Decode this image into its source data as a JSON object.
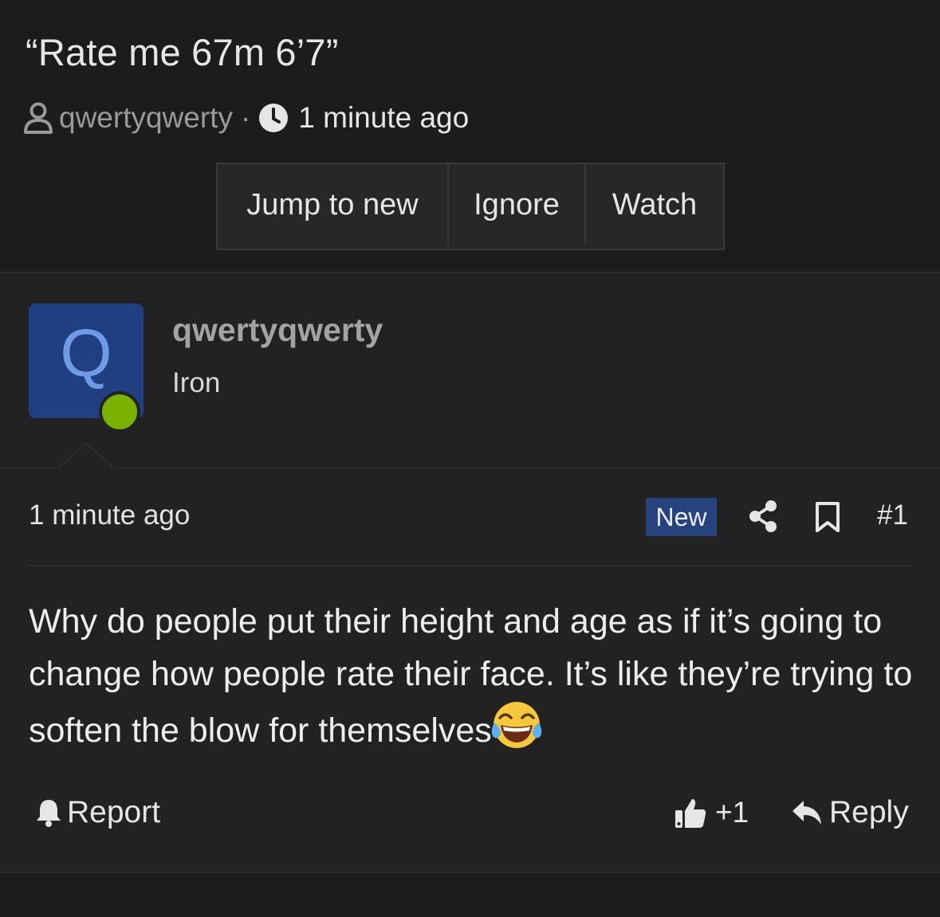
{
  "thread": {
    "title": "“Rate me 67m 6’7”",
    "author": "qwertyqwerty",
    "separator": "·",
    "time": "1 minute ago"
  },
  "actions": {
    "jump_label": "Jump to new",
    "ignore_label": "Ignore",
    "watch_label": "Watch"
  },
  "post": {
    "avatar_letter": "Q",
    "username": "qwertyqwerty",
    "rank": "Iron",
    "time": "1 minute ago",
    "new_badge": "New",
    "number": "#1",
    "body": "Why do people put their height and age as if it’s going to change how people rate their face. It’s like they’re trying to soften the blow for themselves",
    "emoji": "face-with-tears-of-joy",
    "report_label": "Report",
    "like_count": "+1",
    "reply_label": "Reply"
  },
  "colors": {
    "background": "#1c1c1c",
    "post_background": "#222222",
    "avatar": "#1f3f82",
    "online": "#79b300",
    "new_badge": "#26437e"
  }
}
